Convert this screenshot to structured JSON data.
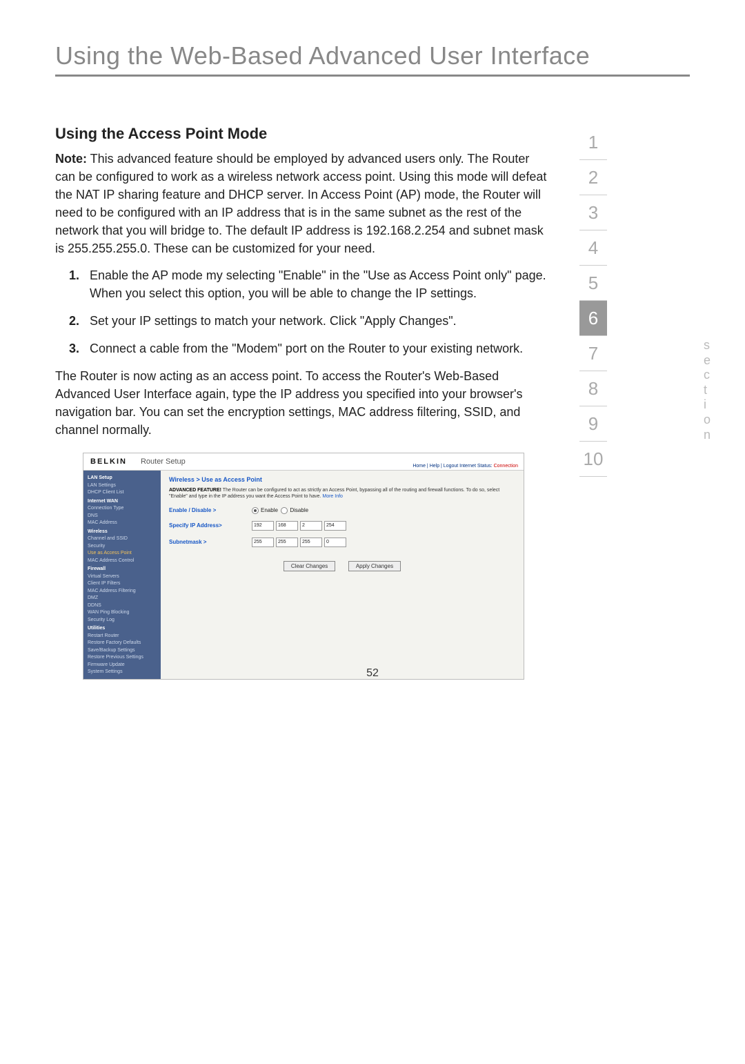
{
  "chapter_title": "Using the Web-Based Advanced User Interface",
  "section_heading": "Using the Access Point Mode",
  "note_label": "Note:",
  "note_body": " This advanced feature should be employed by advanced users only. The Router can be configured to work as a wireless network access point. Using this mode will defeat the NAT IP sharing feature and DHCP server. In Access Point (AP) mode, the Router will need to be configured with an IP address that is in the same subnet as the rest of the network that you will bridge to. The default IP address is 192.168.2.254 and subnet mask is 255.255.255.0. These can be customized for your need.",
  "steps": [
    "Enable the AP mode my selecting \"Enable\" in the \"Use as Access Point only\" page. When you select this option, you will be able to change the IP settings.",
    "Set your IP settings to match your network. Click \"Apply Changes\".",
    "Connect a cable from the \"Modem\" port on the Router to your existing network."
  ],
  "after_text": "The Router is now acting as an access point. To access the Router's Web-Based Advanced User Interface again, type the IP address you specified into your browser's navigation bar. You can set the encryption settings, MAC address filtering, SSID, and channel normally.",
  "page_number": "52",
  "side_tabs": [
    "1",
    "2",
    "3",
    "4",
    "5",
    "6",
    "7",
    "8",
    "9",
    "10"
  ],
  "active_tab": "6",
  "side_label": "section",
  "router": {
    "logo": "BELKIN",
    "header_title": "Router Setup",
    "top_links_pre": "Home | Help | Logout   Internet Status: ",
    "top_links_status": "Connection",
    "breadcrumb": "Wireless > Use as Access Point",
    "desc_bold": "ADVANCED FEATURE!",
    "desc_rest": " The Router can be configured to act as strictly an Access Point, bypassing all of the routing and firewall functions. To do so, select \"Enable\" and type in the IP address you want the Access Point to have. ",
    "desc_more": "More Info",
    "rows": {
      "enable_label": "Enable / Disable >",
      "enable_opt1": "Enable",
      "enable_opt2": "Disable",
      "ip_label": "Specify IP Address>",
      "ip": [
        "192",
        "168",
        "2",
        "254"
      ],
      "mask_label": "Subnetmask >",
      "mask": [
        "255",
        "255",
        "255",
        "0"
      ]
    },
    "buttons": {
      "clear": "Clear Changes",
      "apply": "Apply Changes"
    },
    "sidebar": [
      {
        "t": "LAN Setup",
        "c": "hdr"
      },
      {
        "t": "LAN Settings",
        "c": ""
      },
      {
        "t": "DHCP Client List",
        "c": ""
      },
      {
        "t": "Internet WAN",
        "c": "hdr"
      },
      {
        "t": "Connection Type",
        "c": ""
      },
      {
        "t": "DNS",
        "c": ""
      },
      {
        "t": "MAC Address",
        "c": ""
      },
      {
        "t": "Wireless",
        "c": "hdr"
      },
      {
        "t": "Channel and SSID",
        "c": ""
      },
      {
        "t": "Security",
        "c": ""
      },
      {
        "t": "Use as Access Point",
        "c": "sel"
      },
      {
        "t": "MAC Address Control",
        "c": ""
      },
      {
        "t": "Firewall",
        "c": "hdr"
      },
      {
        "t": "Virtual Servers",
        "c": ""
      },
      {
        "t": "Client IP Filters",
        "c": ""
      },
      {
        "t": "MAC Address Filtering",
        "c": ""
      },
      {
        "t": "DMZ",
        "c": ""
      },
      {
        "t": "DDNS",
        "c": ""
      },
      {
        "t": "WAN Ping Blocking",
        "c": ""
      },
      {
        "t": "Security Log",
        "c": ""
      },
      {
        "t": "Utilities",
        "c": "hdr"
      },
      {
        "t": "Restart Router",
        "c": ""
      },
      {
        "t": "Restore Factory Defaults",
        "c": ""
      },
      {
        "t": "Save/Backup Settings",
        "c": ""
      },
      {
        "t": "Restore Previous Settings",
        "c": ""
      },
      {
        "t": "Firmware Update",
        "c": ""
      },
      {
        "t": "System Settings",
        "c": ""
      }
    ]
  }
}
